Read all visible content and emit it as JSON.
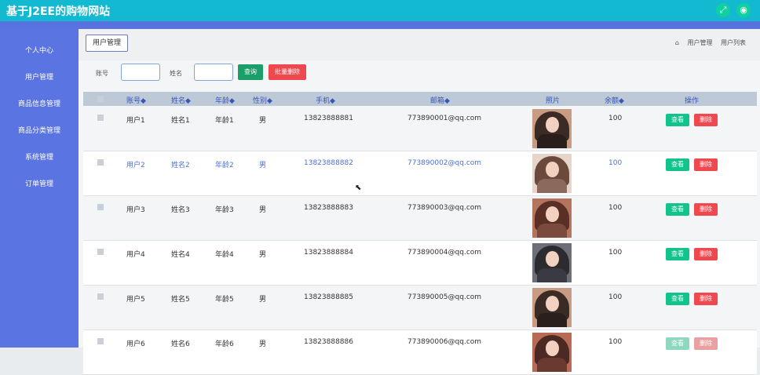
{
  "app": {
    "title": "基于J2EE的购物网站"
  },
  "sidebar": {
    "items": [
      {
        "label": "个人中心"
      },
      {
        "label": "用户管理"
      },
      {
        "label": "商品信息管理"
      },
      {
        "label": "商品分类管理"
      },
      {
        "label": "系统管理"
      },
      {
        "label": "订单管理"
      }
    ]
  },
  "page": {
    "tab": "用户管理",
    "breadcrumb": [
      "用户管理",
      "用户列表"
    ]
  },
  "search": {
    "account_label": "账号",
    "name_label": "姓名",
    "query_label": "查询",
    "batch_delete_label": "批量删除"
  },
  "table": {
    "headers": [
      "账号◆",
      "姓名◆",
      "年龄◆",
      "性别◆",
      "手机◆",
      "邮箱◆",
      "照片",
      "余额◆",
      "操作"
    ],
    "rows": [
      {
        "account": "用户1",
        "name": "姓名1",
        "age": "年龄1",
        "gender": "男",
        "phone": "13823888881",
        "email": "773890001@qq.com",
        "balance": "100"
      },
      {
        "account": "用户2",
        "name": "姓名2",
        "age": "年龄2",
        "gender": "男",
        "phone": "13823888882",
        "email": "773890002@qq.com",
        "balance": "100"
      },
      {
        "account": "用户3",
        "name": "姓名3",
        "age": "年龄3",
        "gender": "男",
        "phone": "13823888883",
        "email": "773890003@qq.com",
        "balance": "100"
      },
      {
        "account": "用户4",
        "name": "姓名4",
        "age": "年龄4",
        "gender": "男",
        "phone": "13823888884",
        "email": "773890004@qq.com",
        "balance": "100"
      },
      {
        "account": "用户5",
        "name": "姓名5",
        "age": "年龄5",
        "gender": "男",
        "phone": "13823888885",
        "email": "773890005@qq.com",
        "balance": "100"
      },
      {
        "account": "用户6",
        "name": "姓名6",
        "age": "年龄6",
        "gender": "男",
        "phone": "13823888886",
        "email": "773890006@qq.com",
        "balance": "100"
      }
    ],
    "view_label": "查看",
    "delete_label": "删除"
  },
  "icons": {
    "top_left": "expand-icon",
    "top_right": "user-icon",
    "breadcrumb": "home-icon",
    "cursor": "pointer-cursor-icon"
  },
  "colors": {
    "topbar": "#13b9d1",
    "sidebar": "#5a74e2",
    "query": "#1a9e6a",
    "danger": "#f0484f",
    "view": "#12c48b"
  }
}
